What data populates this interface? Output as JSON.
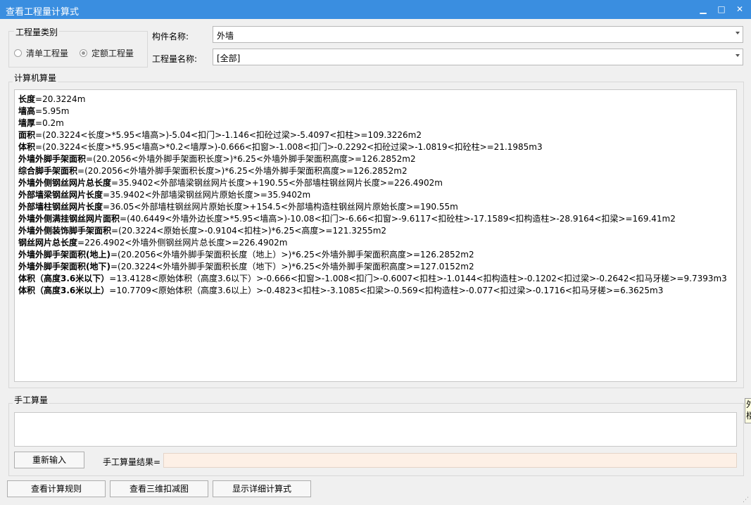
{
  "window": {
    "title": "查看工程量计算式",
    "minimize_glyph": "▁",
    "maximize_glyph": "□",
    "close_glyph": "✕"
  },
  "category": {
    "legend": "工程量类别",
    "options": [
      {
        "label": "清单工程量",
        "checked": false
      },
      {
        "label": "定额工程量",
        "checked": true
      }
    ]
  },
  "component": {
    "label": "构件名称:",
    "value": "外墙"
  },
  "quantity": {
    "label": "工程量名称:",
    "value": "[全部]"
  },
  "computer_calc": {
    "legend": "计算机算量",
    "lines": [
      {
        "name": "长度",
        "expr": "=20.3224m"
      },
      {
        "name": "墙高",
        "expr": "=5.95m"
      },
      {
        "name": "墙厚",
        "expr": "=0.2m"
      },
      {
        "name": "面积",
        "expr": "=(20.3224<长度>*5.95<墙高>)-5.04<扣门>-1.146<扣砼过梁>-5.4097<扣柱>=109.3226m2"
      },
      {
        "name": "体积",
        "expr": "=(20.3224<长度>*5.95<墙高>*0.2<墙厚>)-0.666<扣窗>-1.008<扣门>-0.2292<扣砼过梁>-1.0819<扣砼柱>=21.1985m3"
      },
      {
        "name": "外墙外脚手架面积",
        "expr": "=(20.2056<外墙外脚手架面积长度>)*6.25<外墙外脚手架面积高度>=126.2852m2"
      },
      {
        "name": "综合脚手架面积",
        "expr": "=(20.2056<外墙外脚手架面积长度>)*6.25<外墙外脚手架面积高度>=126.2852m2"
      },
      {
        "name": "外墙外侧钢丝网片总长度",
        "expr": "=35.9402<外部墙梁钢丝网片长度>+190.55<外部墙柱钢丝网片长度>=226.4902m"
      },
      {
        "name": "外部墙梁钢丝网片长度",
        "expr": "=35.9402<外部墙梁钢丝网片原始长度>=35.9402m"
      },
      {
        "name": "外部墙柱钢丝网片长度",
        "expr": "=36.05<外部墙柱钢丝网片原始长度>+154.5<外部墙构造柱钢丝网片原始长度>=190.55m"
      },
      {
        "name": "外墙外侧满挂钢丝网片面积",
        "expr": "=(40.6449<外墙外边长度>*5.95<墙高>)-10.08<扣门>-6.66<扣窗>-9.6117<扣砼柱>-17.1589<扣构造柱>-28.9164<扣梁>=169.41m2"
      },
      {
        "name": "外墙外侧装饰脚手架面积",
        "expr": "=(20.3224<原始长度>-0.9104<扣柱>)*6.25<高度>=121.3255m2"
      },
      {
        "name": "钢丝网片总长度",
        "expr": "=226.4902<外墙外侧钢丝网片总长度>=226.4902m"
      },
      {
        "name": "外墙外脚手架面积(地上)",
        "expr": "=(20.2056<外墙外脚手架面积长度（地上）>)*6.25<外墙外脚手架面积高度>=126.2852m2"
      },
      {
        "name": "外墙外脚手架面积(地下)",
        "expr": "=(20.3224<外墙外脚手架面积长度（地下）>)*6.25<外墙外脚手架面积高度>=127.0152m2"
      },
      {
        "name": "体积（高度3.6米以下）",
        "expr": "=13.4128<原始体积（高度3.6以下）>-0.666<扣窗>-1.008<扣门>-0.6007<扣柱>-1.0144<扣构造柱>-0.1202<扣过梁>-0.2642<扣马牙槎>=9.7393m3"
      },
      {
        "name": "体积（高度3.6米以上）",
        "expr": "=10.7709<原始体积（高度3.6以上）>-0.4823<扣柱>-3.1085<扣梁>-0.569<扣构造柱>-0.077<扣过梁>-0.1716<扣马牙槎>=6.3625m3"
      }
    ]
  },
  "manual_calc": {
    "legend": "手工算量",
    "input_value": "",
    "reinput_label": "重新输入",
    "result_label": "手工算量结果=",
    "result_value": ""
  },
  "footer": {
    "rules_label": "查看计算规则",
    "view3d_label": "查看三维扣减图",
    "detail_label": "显示详细计算式"
  },
  "tooltip": {
    "text": "外楼"
  }
}
